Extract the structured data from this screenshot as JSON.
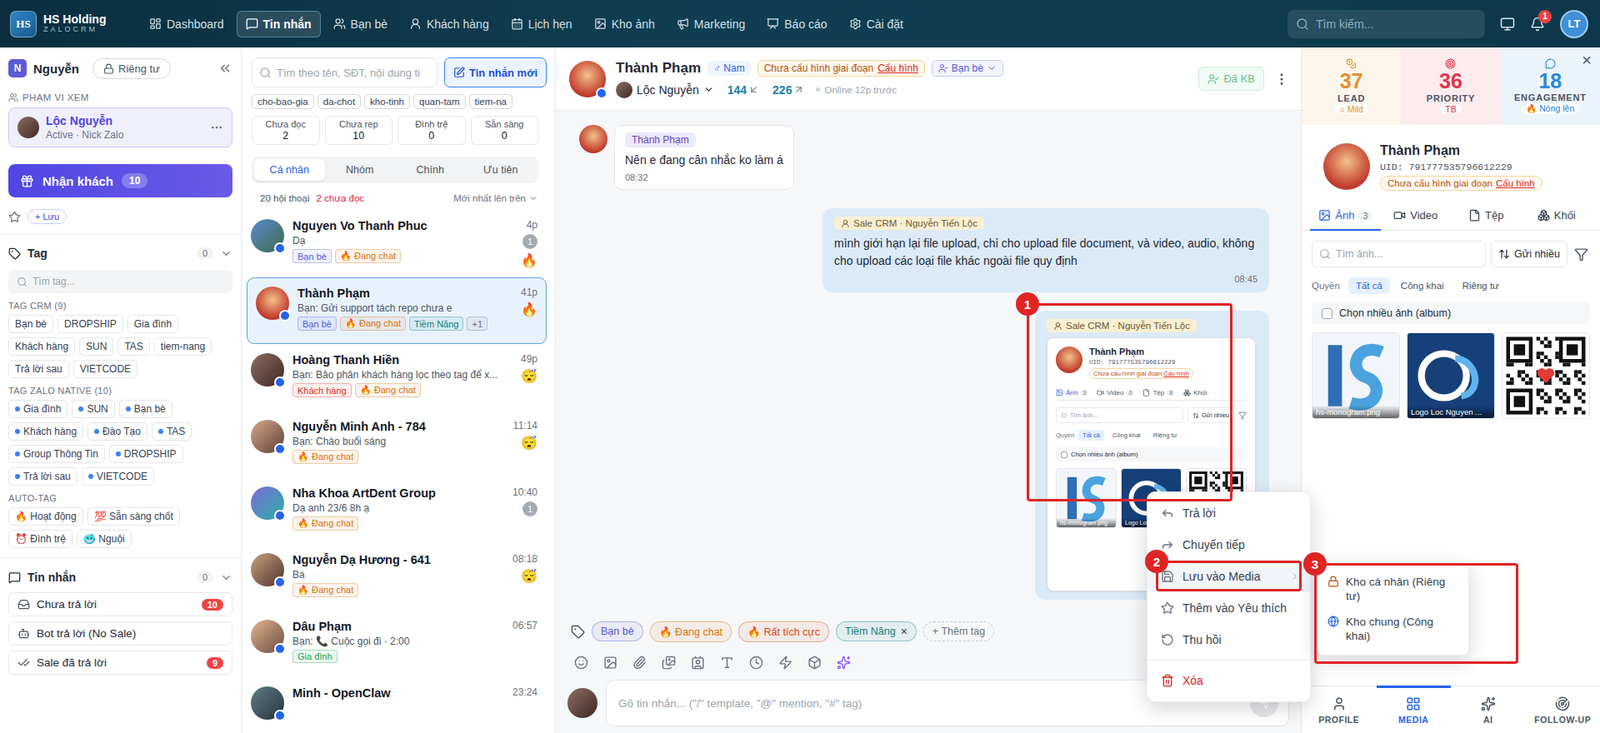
{
  "brand": {
    "mark": "HS",
    "name": "HS Holding",
    "sub": "ZALOCRM"
  },
  "nav": [
    {
      "label": "Dashboard",
      "selected": false
    },
    {
      "label": "Tin nhắn",
      "selected": true
    },
    {
      "label": "Bạn bè",
      "selected": false
    },
    {
      "label": "Khách hàng",
      "selected": false
    },
    {
      "label": "Lịch hẹn",
      "selected": false
    },
    {
      "label": "Kho ảnh",
      "selected": false
    },
    {
      "label": "Marketing",
      "selected": false
    },
    {
      "label": "Báo cáo",
      "selected": false
    },
    {
      "label": "Cài đặt",
      "selected": false
    }
  ],
  "search": {
    "placeholder": "Tìm kiếm..."
  },
  "notifications": "1",
  "avatar": "LT",
  "sidebar": {
    "user": {
      "initial": "N",
      "name": "Nguyễn",
      "privacy": "Riêng tư"
    },
    "scope": {
      "label": "PHẠM VI XEM",
      "name": "Lộc Nguyễn",
      "status": "Active · Nick Zalo"
    },
    "receive": {
      "label": "Nhận khách",
      "count": "10"
    },
    "save": "+ Lưu",
    "tags": {
      "title": "Tag",
      "count": "0",
      "placeholder": "Tìm tag...",
      "groups": [
        {
          "title": "TAG CRM (9)",
          "kind": "crm",
          "items": [
            "Bạn bè",
            "DROPSHIP",
            "Gia đình",
            "Khách hàng",
            "SUN",
            "TAS",
            "tiem-nang",
            "Trả lời sau",
            "VIETCODE"
          ]
        },
        {
          "title": "TAG ZALO NATIVE (10)",
          "kind": "native",
          "items": [
            "Gia đình",
            "SUN",
            "Bạn bè",
            "Khách hàng",
            "Đào Tạo",
            "TAS",
            "Group Thông Tin",
            "DROPSHIP",
            "Trả lời sau",
            "VIETCODE"
          ]
        },
        {
          "title": "AUTO-TAG",
          "kind": "auto",
          "items": [
            "🔥 Hoạt động",
            "💯 Sẵn sàng chốt",
            "⏰ Đình trệ",
            "🥶 Nguội"
          ]
        }
      ]
    },
    "messages": {
      "title": "Tin nhắn",
      "count": "0",
      "items": [
        {
          "label": "Chưa trả lời",
          "count": "10"
        },
        {
          "label": "Bot trả lời (No Sale)"
        },
        {
          "label": "Sale đã trả lời",
          "count": "9"
        }
      ]
    }
  },
  "inbox": {
    "placeholder": "Tìm theo tên, SĐT, nội dung ti",
    "new_button": "Tin nhắn mới",
    "filters": [
      "cho-bao-gia",
      "da-chot",
      "kho-tinh",
      "quan-tam",
      "tiem-na"
    ],
    "stats": [
      {
        "label": "Chưa đọc",
        "value": "2"
      },
      {
        "label": "Chưa rep",
        "value": "10"
      },
      {
        "label": "Đình trệ",
        "value": "0"
      },
      {
        "label": "Sẵn sàng",
        "value": "0"
      }
    ],
    "tabs": [
      {
        "label": "Cá nhân",
        "selected": true
      },
      {
        "label": "Nhóm",
        "selected": false
      },
      {
        "label": "Chính",
        "selected": false
      },
      {
        "label": "Ưu tiên",
        "selected": false
      }
    ],
    "summary": "20 hội thoại",
    "unread": "2 chưa đọc",
    "sort": "Mới nhất lên trên",
    "conversations": [
      {
        "name": "Nguyen Vo Thanh Phuc",
        "preview": "Dạ",
        "time": "4p",
        "unread": "1",
        "mood": "🔥",
        "selected": false,
        "tags": [
          {
            "label": "Bạn bè",
            "color": "#4f5bd5"
          },
          {
            "label": "🔥 Đang chat",
            "color": "#d9730d"
          }
        ]
      },
      {
        "name": "Thành Phạm",
        "preview": "Bạn: Gửi support tách repo chưa e",
        "time": "41p",
        "mood": "🔥",
        "selected": true,
        "tags": [
          {
            "label": "Bạn bè",
            "color": "#4f5bd5"
          },
          {
            "label": "🔥 Đang chat",
            "color": "#d9730d"
          },
          {
            "label": "Tiềm Năng",
            "color": "#12807f"
          },
          {
            "label": "+1",
            "color": "#6b7280"
          }
        ]
      },
      {
        "name": "Hoàng Thanh Hiền",
        "preview": "Bạn: Bảo phân khách hàng lọc theo tag để x...",
        "time": "49p",
        "mood": "😴",
        "selected": false,
        "tags": [
          {
            "label": "Khách hàng",
            "color": "#d92d20"
          },
          {
            "label": "🔥 Đang chat",
            "color": "#d9730d"
          }
        ]
      },
      {
        "name": "Nguyễn Minh Anh - 784",
        "preview": "Bạn: Chào buổi sáng",
        "time": "11:14",
        "mood": "😴",
        "selected": false,
        "tags": [
          {
            "label": "🔥 Đang chat",
            "color": "#d9730d"
          }
        ]
      },
      {
        "name": "Nha Khoa ArtDent Group",
        "preview": "Dạ anh 23/6 8h ạ",
        "time": "10:40",
        "unread": "1",
        "selected": false,
        "tags": [
          {
            "label": "🔥 Đang chat",
            "color": "#d9730d"
          }
        ]
      },
      {
        "name": "Nguyễn Dạ Hương - 641",
        "preview": "Ba",
        "time": "08:18",
        "mood": "😴",
        "selected": false,
        "tags": [
          {
            "label": "🔥 Đang chat",
            "color": "#d9730d"
          }
        ]
      },
      {
        "name": "Dâu Phạm",
        "preview": "Bạn: 📞 Cuộc gọi đi · 2:00",
        "time": "06:57",
        "selected": false,
        "tags": [
          {
            "label": "Gia đình",
            "color": "#16a34a"
          }
        ]
      },
      {
        "name": "Minh - OpenClaw",
        "preview": "",
        "time": "23:24",
        "selected": false,
        "tags": []
      }
    ]
  },
  "chat": {
    "name": "Thành Phạm",
    "gender": "♂ Nam",
    "stage": "Chưa cấu hình giai đoạn",
    "stage_link": "Cấu hình",
    "relation": "Bạn bè",
    "kb": "Đã KB",
    "owner": "Lộc Nguyễn",
    "stat_in": "144",
    "stat_out": "226",
    "online": "Online 12p trước",
    "messages": [
      {
        "kind": "in",
        "tag": "Thành Phạm",
        "text": "Nên e đang cân nhắc ko làm á",
        "time": "08:32"
      },
      {
        "kind": "out",
        "sender": "Sale CRM · Nguyễn Tiến Lộc",
        "text": "mình giới hạn lại file upload, chỉ cho upload file document, và video, audio, không cho upload các loại file khác ngoài file quy định",
        "time": "08:45"
      },
      {
        "kind": "image",
        "sender": "Sale CRM · Nguyễn Tiến Lộc"
      }
    ],
    "shot": {
      "name": "Thành Phạm",
      "uid": "UID: 791777535796612229",
      "stage": "Chưa cấu hình giai đoạn",
      "stage_link": "Cấu hình",
      "tabs": [
        {
          "label": "Ảnh",
          "count": "3",
          "selected": true
        },
        {
          "label": "Video",
          "count": "0",
          "selected": false
        },
        {
          "label": "Tệp",
          "count": "8",
          "selected": false
        },
        {
          "label": "Khối",
          "selected": false
        }
      ],
      "search": "Tìm ảnh...",
      "send": "Gửi nhiều",
      "scope_label": "Quyền",
      "scopes": [
        {
          "label": "Tất cả",
          "selected": true
        },
        {
          "label": "Công khai",
          "selected": false
        },
        {
          "label": "Riêng tư",
          "selected": false
        }
      ],
      "album": "Chọn nhiều ảnh (album)",
      "thumbs": [
        {
          "caption": "hs-monogram.png",
          "kind": "monogram"
        },
        {
          "caption": "Logo Loc",
          "kind": "logo"
        },
        {
          "kind": "qr"
        }
      ]
    },
    "tags": [
      {
        "label": "Bạn bè",
        "color": "#4f5bd5",
        "removable": false
      },
      {
        "label": "🔥 Đang chat",
        "color": "#d9730d",
        "removable": false
      },
      {
        "label": "🔥 Rất tích cực",
        "color": "#d9480f",
        "removable": false
      },
      {
        "label": "Tiềm Năng",
        "color": "#12807f",
        "removable": true
      }
    ],
    "remove": "×",
    "add_tag": "+ Thêm tag",
    "placeholder": "Gõ tin nhắn... (\"/\" template, \"@\" mention, \"#\" tag)"
  },
  "context_menu": {
    "items": [
      {
        "label": "Trả lời",
        "kind": "normal",
        "selected": false
      },
      {
        "label": "Chuyển tiếp",
        "kind": "normal",
        "selected": false
      },
      {
        "label": "Lưu vào Media",
        "kind": "submenu",
        "selected": true
      },
      {
        "label": "Thêm vào Yêu thích",
        "kind": "normal",
        "selected": false
      },
      {
        "label": "Thu hồi",
        "kind": "normal",
        "selected": false
      },
      {
        "label": "Xóa",
        "kind": "danger",
        "selected": false
      }
    ],
    "submenu": [
      "Kho cá nhân (Riêng tư)",
      "Kho chung (Công khai)"
    ]
  },
  "annotations": [
    "1",
    "2",
    "3"
  ],
  "panel": {
    "close": "×",
    "scores": [
      {
        "value": "37",
        "label": "LEAD",
        "sub": "○ Mild",
        "color": "#e0902d"
      },
      {
        "value": "36",
        "label": "PRIORITY",
        "sub": "TB",
        "color": "#e0344a"
      },
      {
        "value": "18",
        "label": "ENGAGEMENT",
        "sub": "🔥 Nóng lên",
        "color": "#2d86d4"
      }
    ],
    "name": "Thành Phạm",
    "uid": "UID: 791777535796612229",
    "stage": "Chưa cấu hình giai đoạn",
    "stage_link": "Cấu hình",
    "tabs": [
      {
        "label": "Ảnh",
        "count": "3",
        "selected": true
      },
      {
        "label": "Video",
        "selected": false
      },
      {
        "label": "Tệp",
        "selected": false
      },
      {
        "label": "Khối",
        "selected": false
      }
    ],
    "search": "Tìm ảnh...",
    "send": "Gửi nhiều",
    "scope_label": "Quyền",
    "scopes": [
      {
        "label": "Tất cả",
        "selected": true
      },
      {
        "label": "Công khai",
        "selected": false
      },
      {
        "label": "Riêng tư",
        "selected": false
      }
    ],
    "album": {
      "label": "Chọn nhiều ảnh (album)",
      "checked": false
    },
    "thumbs": [
      {
        "caption": "hs-monogram.png",
        "kind": "monogram"
      },
      {
        "caption": "Logo Loc Nguyen ...",
        "kind": "logo"
      },
      {
        "kind": "qr"
      }
    ],
    "bottom": [
      {
        "label": "PROFILE",
        "selected": false
      },
      {
        "label": "MEDIA",
        "selected": true
      },
      {
        "label": "AI",
        "selected": false
      },
      {
        "label": "FOLLOW-UP",
        "selected": false
      }
    ]
  }
}
